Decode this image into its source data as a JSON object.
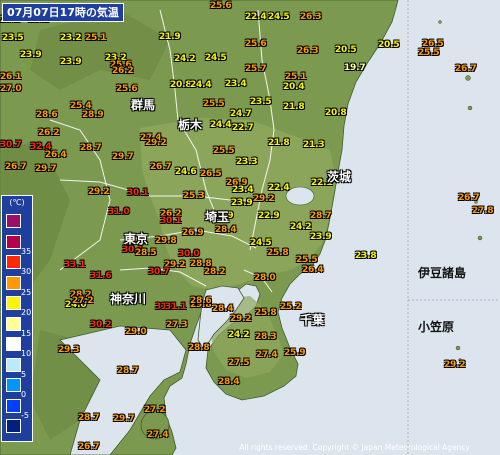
{
  "title": "07月07日17時の気温",
  "legend": {
    "unit": "(℃)",
    "items": [
      {
        "label": "",
        "color": "#9b0f6b"
      },
      {
        "label": "35",
        "color": "#b4004f"
      },
      {
        "label": "30",
        "color": "#ff2800"
      },
      {
        "label": "25",
        "color": "#ff9900"
      },
      {
        "label": "20",
        "color": "#faf500"
      },
      {
        "label": "15",
        "color": "#ffff96"
      },
      {
        "label": "10",
        "color": "#ffffff"
      },
      {
        "label": "5",
        "color": "#b9ebff"
      },
      {
        "label": "0",
        "color": "#0096ff"
      },
      {
        "label": "-5",
        "color": "#0041ff"
      },
      {
        "label": "",
        "color": "#002080"
      }
    ]
  },
  "places": [
    {
      "id": "gunma",
      "label": "群馬"
    },
    {
      "id": "tochigi",
      "label": "栃木"
    },
    {
      "id": "ibaraki",
      "label": "茨城"
    },
    {
      "id": "saitama",
      "label": "埼玉"
    },
    {
      "id": "tokyo",
      "label": "東京"
    },
    {
      "id": "kanagawa",
      "label": "神奈川"
    },
    {
      "id": "chiba",
      "label": "千葉"
    }
  ],
  "island_labels": [
    {
      "id": "izu",
      "label": "伊豆諸島"
    },
    {
      "id": "ogasawara",
      "label": "小笠原"
    }
  ],
  "temperatures": [
    "20.9",
    "20.8",
    "25.6",
    "22.4",
    "24.5",
    "26.3",
    "23.2",
    "23.5",
    "25.1",
    "20.5",
    "23.9",
    "23.2",
    "21.9",
    "25.6",
    "26.3",
    "20.5",
    "19.7",
    "26.5",
    "25.5",
    "23.9",
    "25.6",
    "24.5",
    "25.7",
    "25.1",
    "26.2",
    "24.2",
    "26.7",
    "26.1",
    "20.8",
    "24.4",
    "23.4",
    "20.4",
    "27.0",
    "25.6",
    "25.5",
    "23.5",
    "21.8",
    "25.4",
    "20.8",
    "28.6",
    "28.9",
    "24.7",
    "24.4",
    "22.7",
    "26.2",
    "27.4",
    "21.8",
    "30.7",
    "32.4",
    "28.7",
    "29.2",
    "25.5",
    "21.3",
    "26.4",
    "29.7",
    "26.7",
    "29.7",
    "26.7",
    "23.3",
    "24.6",
    "26.5",
    "22.1",
    "26.9",
    "29.2",
    "30.1",
    "25.3",
    "23.4",
    "22.4",
    "26.7",
    "29.2",
    "23.9",
    "22.9",
    "22.9",
    "27.8",
    "31.0",
    "26.2",
    "30.1",
    "28.7",
    "26.9",
    "24.2",
    "23.9",
    "28.4",
    "29.8",
    "24.5",
    "30.1",
    "28.5",
    "25.5",
    "28.8",
    "23.8",
    "33.1",
    "29.2",
    "30.0",
    "25.8",
    "26.4",
    "31.6",
    "30.7",
    "28.2",
    "28.0",
    "31.1",
    "28.2",
    "24.0",
    "28.4",
    "29.8",
    "27.2",
    "31.1",
    "28.6",
    "29.2",
    "25.8",
    "25.2",
    "30.2",
    "29.0",
    "28.3",
    "27.3",
    "24.2",
    "28.8",
    "27.4",
    "25.9",
    "29.2",
    "29.3",
    "27.5",
    "28.4",
    "28.7",
    "27.2",
    "28.7",
    "29.7",
    "27.4",
    "26.7"
  ],
  "copyright": "All rights reserved. Copyright © Japan Meteorological Agency"
}
